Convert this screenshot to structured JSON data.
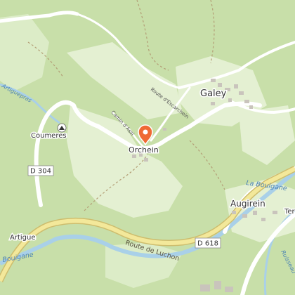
{
  "map": {
    "colors": {
      "forest": "#c5dea6",
      "meadow": "#e2eed0",
      "road_major_fill": "#f3e89a",
      "road_major_casing": "#cdbd6e",
      "road_minor": "#ffffff",
      "river": "#a9d0e8",
      "river_label": "#4d84b4",
      "buildings": "#c9c4bc",
      "marker": "#ef6a34"
    },
    "places": {
      "galey": "Galey",
      "orchein": "Orchein",
      "augirein": "Augirein",
      "coumeres": "Coumeres",
      "artigue": "Artigue",
      "tera_partial": "Ter"
    },
    "roads": {
      "d304": "D 304",
      "d618": "D 618",
      "route_de_luchon": "Route de Luchon",
      "route_escarcheim": "Route d'Escarchein",
      "camin_dassi": "Camin d'Assi"
    },
    "waterways": {
      "la_bouigane_east": "La Bouigane",
      "la_bouigane_west": "Bouigane",
      "artiguepras": "Artiguepras",
      "ruisseau": "Ruisseau"
    },
    "icons": {
      "location_pin": "location-pin-icon",
      "cave": "cave-icon"
    }
  }
}
